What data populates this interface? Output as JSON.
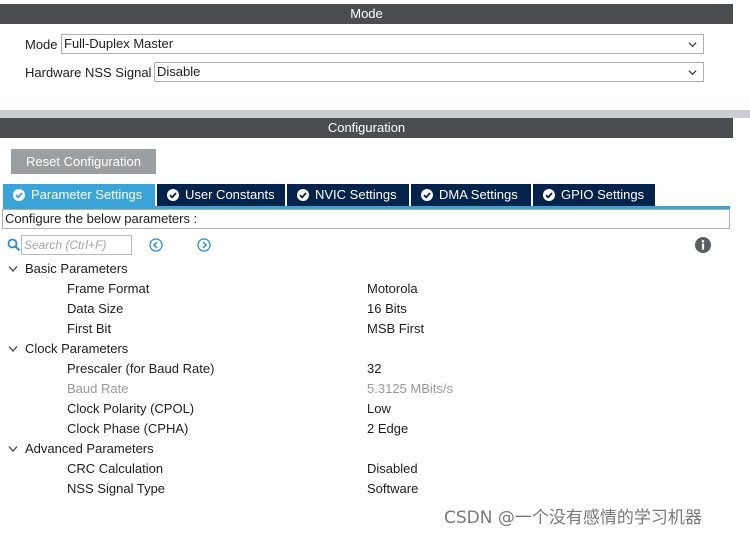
{
  "mode_panel": {
    "title": "Mode",
    "mode_label": "Mode",
    "mode_value": "Full-Duplex Master",
    "nss_label": "Hardware NSS Signal",
    "nss_value": "Disable"
  },
  "config_panel": {
    "title": "Configuration",
    "reset_button": "Reset Configuration",
    "tabs": [
      {
        "label": "Parameter Settings",
        "active": true
      },
      {
        "label": "User Constants",
        "active": false
      },
      {
        "label": "NVIC Settings",
        "active": false
      },
      {
        "label": "DMA Settings",
        "active": false
      },
      {
        "label": "GPIO Settings",
        "active": false
      }
    ],
    "configure_text": "Configure the below parameters :",
    "search_placeholder": "Search (Ctrl+F)"
  },
  "groups": [
    {
      "label": "Basic Parameters",
      "params": [
        {
          "name": "Frame Format",
          "value": "Motorola"
        },
        {
          "name": "Data Size",
          "value": "16 Bits"
        },
        {
          "name": "First Bit",
          "value": "MSB First"
        }
      ]
    },
    {
      "label": "Clock Parameters",
      "params": [
        {
          "name": "Prescaler (for Baud Rate)",
          "value": "32"
        },
        {
          "name": "Baud Rate",
          "value": "5.3125 MBits/s",
          "disabled": true
        },
        {
          "name": "Clock Polarity (CPOL)",
          "value": "Low"
        },
        {
          "name": "Clock Phase (CPHA)",
          "value": "2 Edge"
        }
      ]
    },
    {
      "label": "Advanced Parameters",
      "params": [
        {
          "name": "CRC Calculation",
          "value": "Disabled"
        },
        {
          "name": "NSS Signal Type",
          "value": "Software"
        }
      ]
    }
  ],
  "watermark": "CSDN @一个没有感情的学习机器",
  "colors": {
    "header_bar": "#4a4e51",
    "tab_active": "#3aa4d9",
    "tab_inactive": "#03234b",
    "reset_button": "#9c9fa2",
    "separator": "#c9cdd1"
  }
}
